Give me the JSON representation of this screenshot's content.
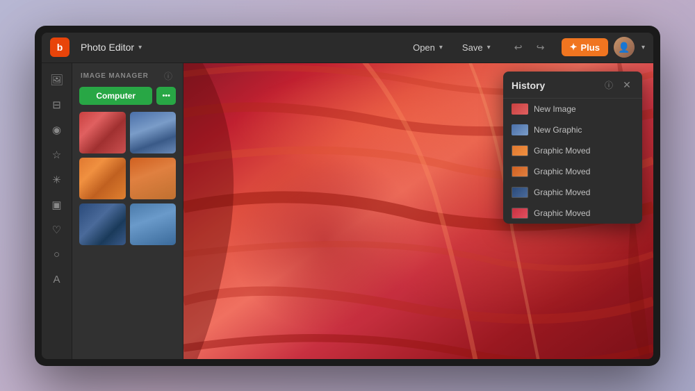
{
  "app": {
    "logo_letter": "b",
    "title": "Photo Editor",
    "title_chevron": "▾"
  },
  "topbar": {
    "open_label": "Open",
    "save_label": "Save",
    "open_chevron": "▾",
    "save_chevron": "▾",
    "undo_symbol": "↩",
    "redo_symbol": "↪",
    "plus_label": "Plus",
    "plus_icon": "✦",
    "avatar_chevron": "▾"
  },
  "sidebar": {
    "icons": [
      {
        "name": "image-icon",
        "symbol": "🖼"
      },
      {
        "name": "sliders-icon",
        "symbol": "⊟"
      },
      {
        "name": "eye-icon",
        "symbol": "◉"
      },
      {
        "name": "star-icon",
        "symbol": "☆"
      },
      {
        "name": "effects-icon",
        "symbol": "✳"
      },
      {
        "name": "frame-icon",
        "symbol": "▣"
      },
      {
        "name": "heart-icon",
        "symbol": "♡"
      },
      {
        "name": "shape-icon",
        "symbol": "○"
      },
      {
        "name": "text-icon",
        "symbol": "A"
      }
    ]
  },
  "panel": {
    "title": "IMAGE MANAGER",
    "info_icon": "ⓘ",
    "computer_label": "Computer",
    "more_dots": "•••",
    "thumbnails": [
      {
        "id": 1,
        "class": "thumb-1",
        "label": "Red canyon photo 1"
      },
      {
        "id": 2,
        "class": "thumb-2",
        "label": "Mountain photo 1"
      },
      {
        "id": 3,
        "class": "thumb-3",
        "label": "Sunset photo 1"
      },
      {
        "id": 4,
        "class": "thumb-4",
        "label": "Sunset photo 2"
      },
      {
        "id": 5,
        "class": "thumb-5",
        "label": "Mountain photo 2"
      },
      {
        "id": 6,
        "class": "thumb-6",
        "label": "Mountain photo 3"
      }
    ]
  },
  "history": {
    "title": "History",
    "info_icon": "ⓘ",
    "close_icon": "✕",
    "items": [
      {
        "id": 1,
        "thumb_class": "h-thumb-1",
        "label": "New Image"
      },
      {
        "id": 2,
        "thumb_class": "h-thumb-2",
        "label": "New Graphic"
      },
      {
        "id": 3,
        "thumb_class": "h-thumb-3",
        "label": "Graphic Moved"
      },
      {
        "id": 4,
        "thumb_class": "h-thumb-4",
        "label": "Graphic Moved"
      },
      {
        "id": 5,
        "thumb_class": "h-thumb-5",
        "label": "Graphic Moved"
      },
      {
        "id": 6,
        "thumb_class": "h-thumb-6",
        "label": "Graphic Moved"
      }
    ]
  }
}
